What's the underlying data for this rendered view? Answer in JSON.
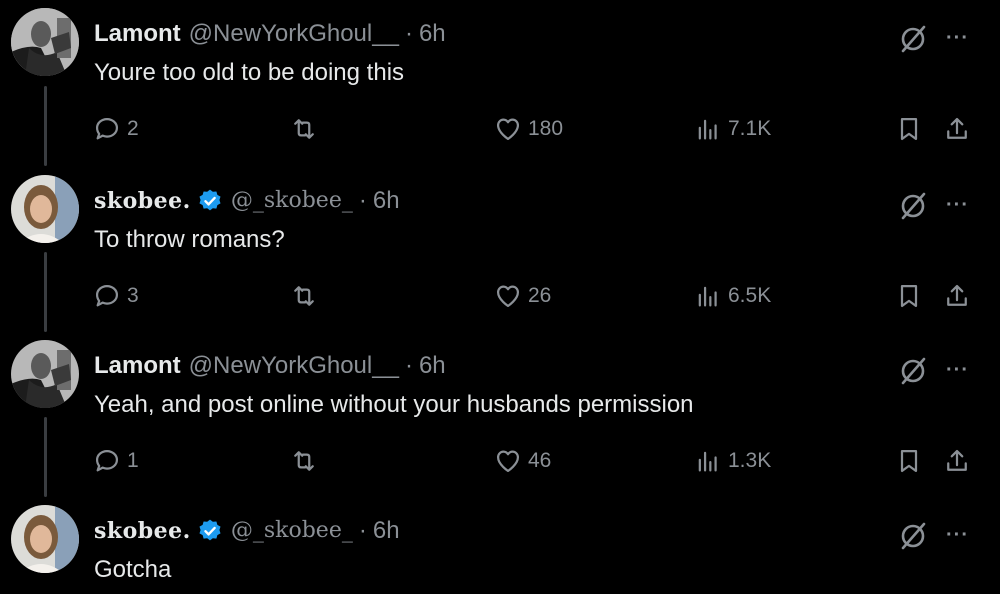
{
  "tweets": [
    {
      "name": "Lamont",
      "handle": "@NewYorkGhoul__",
      "separator": "·",
      "time": "6h",
      "verified": false,
      "avatar": "black-and-white-portrait",
      "text": "Youre too old to be doing this",
      "replies": "2",
      "retweets": "",
      "likes": "180",
      "views": "7.1K"
    },
    {
      "name": "skobee.",
      "handle": "@_skobee_",
      "separator": "·",
      "time": "6h",
      "verified": true,
      "avatar": "woman-selfie",
      "text": "To throw romans?",
      "replies": "3",
      "retweets": "",
      "likes": "26",
      "views": "6.5K"
    },
    {
      "name": "Lamont",
      "handle": "@NewYorkGhoul__",
      "separator": "·",
      "time": "6h",
      "verified": false,
      "avatar": "black-and-white-portrait",
      "text": "Yeah, and post online without your husbands permission",
      "replies": "1",
      "retweets": "",
      "likes": "46",
      "views": "1.3K"
    },
    {
      "name": "skobee.",
      "handle": "@_skobee_",
      "separator": "·",
      "time": "6h",
      "verified": true,
      "avatar": "woman-selfie",
      "text": "Gotcha"
    }
  ],
  "icons": {
    "more": "···",
    "grok": "grok-icon",
    "reply": "reply-icon",
    "retweet": "retweet-icon",
    "like": "heart-icon",
    "views": "views-icon",
    "bookmark": "bookmark-icon",
    "share": "share-icon"
  },
  "colors": {
    "background": "#000000",
    "text": "#e7e9ea",
    "muted": "#8b9096",
    "thread_line": "#3a3d41",
    "verified": "#1d9bf0"
  }
}
